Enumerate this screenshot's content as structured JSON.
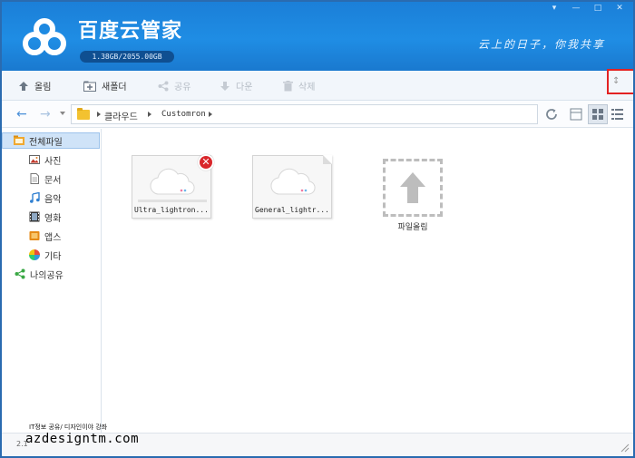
{
  "header": {
    "app_title": "百度云管家",
    "quota": "1.38GB/2055.00GB",
    "slogan": "云上的日子，你我共享",
    "window_controls": [
      "▾",
      "—",
      "□",
      "✕"
    ]
  },
  "toolbar": {
    "upload_label": "올림",
    "new_folder_label": "새폴더",
    "share_label": "공유",
    "download_label": "다운",
    "delete_label": "삭제",
    "extra_label": "↕"
  },
  "addressbar": {
    "crumbs": [
      "클라우드",
      "Customron"
    ]
  },
  "sidebar": {
    "items": [
      {
        "label": "전체파일",
        "icon": "all-files-icon"
      },
      {
        "label": "사진",
        "icon": "photo-icon"
      },
      {
        "label": "문서",
        "icon": "document-icon"
      },
      {
        "label": "음악",
        "icon": "music-icon"
      },
      {
        "label": "영화",
        "icon": "film-icon"
      },
      {
        "label": "앱스",
        "icon": "apps-icon"
      },
      {
        "label": "기타",
        "icon": "other-icon"
      },
      {
        "label": "나의공유",
        "icon": "share-icon"
      }
    ]
  },
  "files": [
    {
      "name": "Ultra_lightron...",
      "error": true
    },
    {
      "name": "General_lightr..."
    }
  ],
  "upload_tile": {
    "label": "파일올림"
  },
  "footer": {
    "watermark_small": "IT정보 공유/ 디자인이야 강좌",
    "watermark_big": "azdesigntm.com",
    "number": "2.1"
  },
  "colors": {
    "header_blue": "#1f8de4",
    "highlight_red": "#e32222",
    "error_red": "#d9262b"
  }
}
